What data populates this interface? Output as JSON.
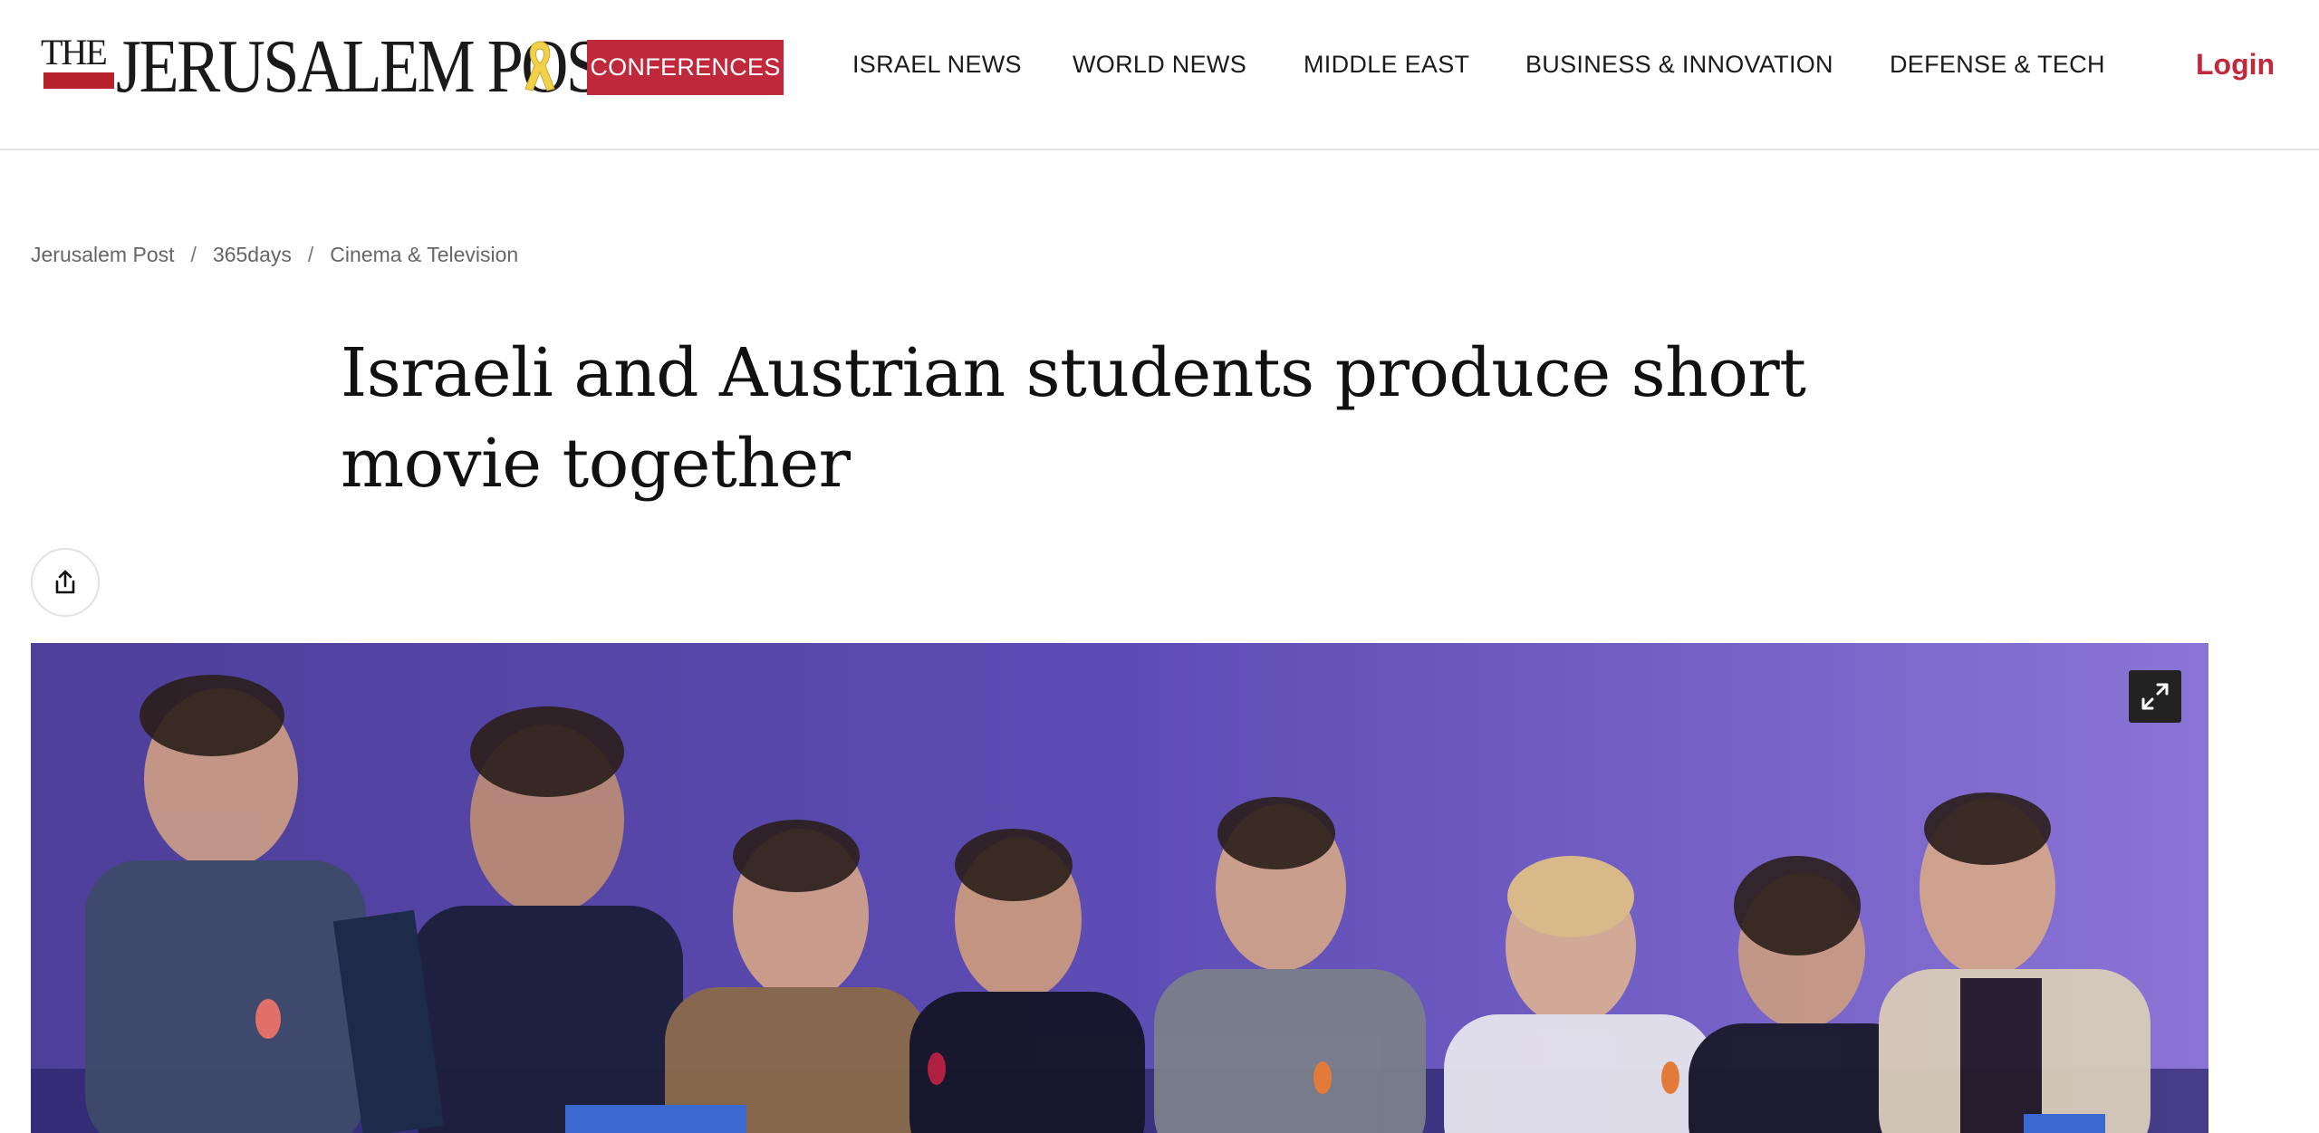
{
  "header": {
    "logo_text_small": "THE",
    "logo_text_main": "JERUSALEM POST",
    "conferences_label": "CONFERENCES",
    "nav": [
      {
        "label": "ISRAEL NEWS"
      },
      {
        "label": "WORLD NEWS"
      },
      {
        "label": "MIDDLE EAST"
      },
      {
        "label": "BUSINESS & INNOVATION"
      },
      {
        "label": "DEFENSE & TECH"
      }
    ],
    "login_label": "Login"
  },
  "breadcrumb": {
    "items": [
      "Jerusalem Post",
      "365days",
      "Cinema & Television"
    ],
    "separator": "/"
  },
  "article": {
    "title": "Israeli and Austrian students produce short movie together"
  },
  "icons": {
    "share": "share-icon",
    "expand": "expand-icon",
    "ribbon": "yellow-ribbon-icon"
  },
  "colors": {
    "brand_red": "#c0293b",
    "ribbon_yellow": "#f2d14a",
    "hero_purple": "#6b58c0"
  }
}
